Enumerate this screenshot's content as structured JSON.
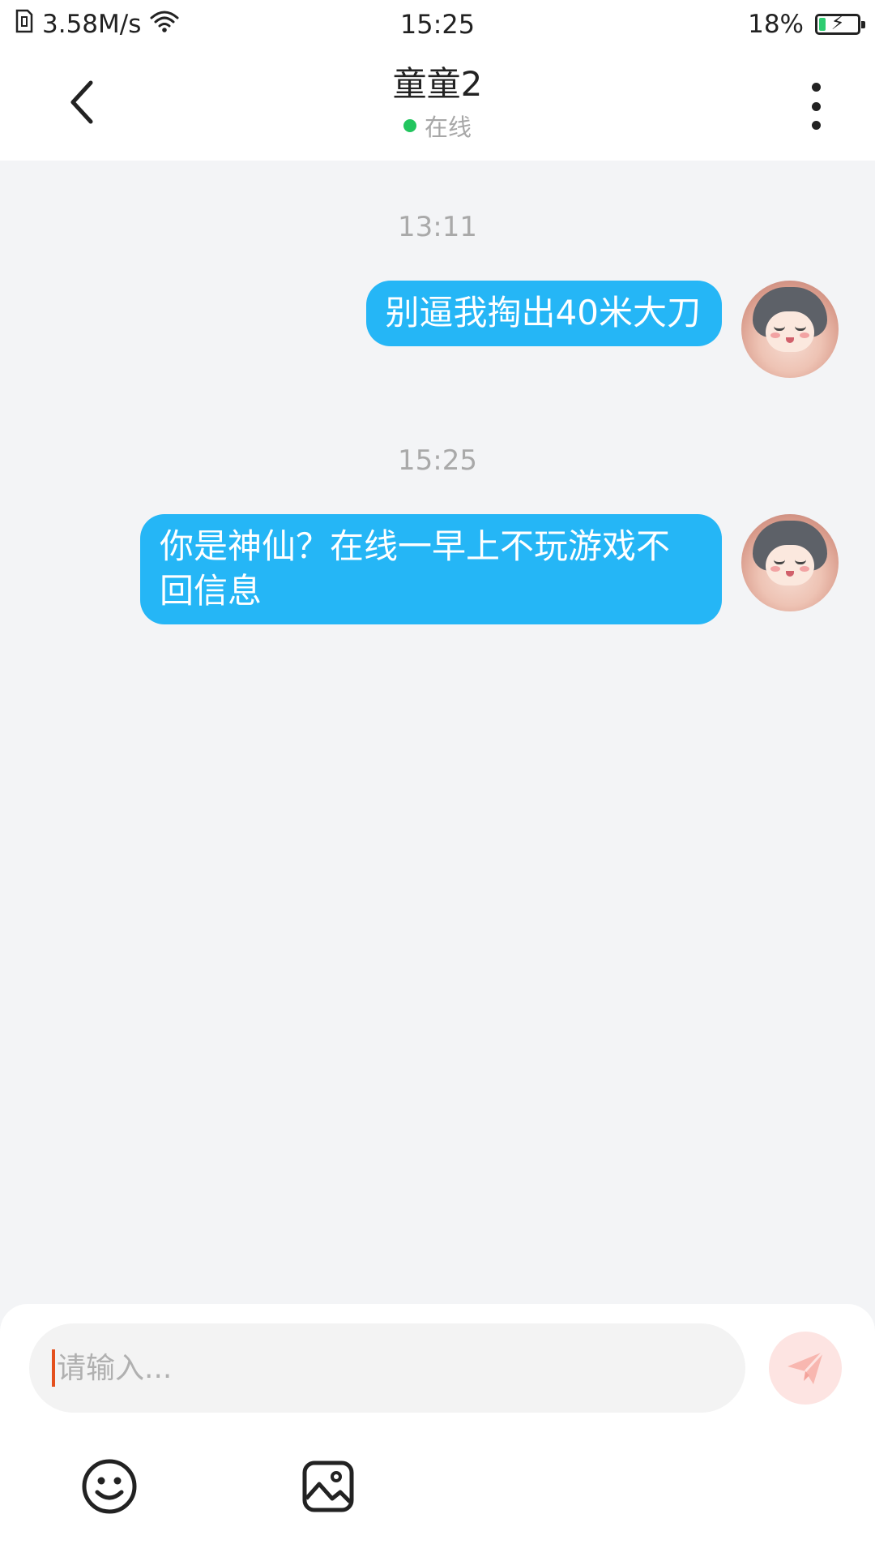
{
  "status_bar": {
    "network_speed": "3.58M/s",
    "time": "15:25",
    "battery": "18%",
    "battery_level": 0.18,
    "colors": {
      "battery_fill": "#2ecc71"
    },
    "icons": [
      "sim-icon",
      "wifi-icon",
      "battery-charging-icon"
    ]
  },
  "header": {
    "title": "童童2",
    "status": "在线",
    "colors": {
      "online_dot": "#22c55e"
    },
    "icons": [
      "back-arrow-icon",
      "more-vertical-icon"
    ]
  },
  "messages": [
    {
      "time": "13:11",
      "text": "别逼我掏出40米大刀",
      "sender": "self"
    },
    {
      "time": "15:25",
      "text": "你是神仙？在线一早上不玩游戏不回信息",
      "sender": "self"
    }
  ],
  "composer": {
    "placeholder": "请输入...",
    "value": "",
    "icons": [
      "send-icon",
      "emoji-icon",
      "image-icon"
    ],
    "colors": {
      "send_button_bg": "#fde4e2",
      "send_icon": "#f8b7b0",
      "bubble": "#25b6f6"
    }
  }
}
